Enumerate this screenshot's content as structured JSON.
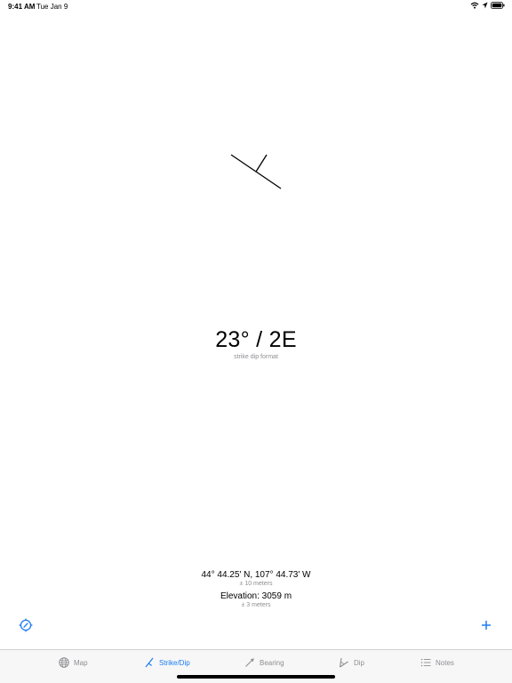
{
  "status": {
    "time": "9:41 AM",
    "date": "Tue Jan 9",
    "icons": [
      "wifi-icon",
      "location-arrow-icon",
      "battery-icon"
    ]
  },
  "reading": {
    "value": "23° / 2E",
    "format": "strike dip format"
  },
  "location": {
    "coords": "44° 44.25' N, 107° 44.73' W",
    "coords_accuracy": "± 10 meters",
    "elevation": "Elevation: 3059 m",
    "elevation_accuracy": "± 3 meters"
  },
  "tabs": [
    {
      "label": "Map",
      "icon": "globe-icon",
      "active": false
    },
    {
      "label": "Strike/Dip",
      "icon": "strike-dip-icon",
      "active": true
    },
    {
      "label": "Bearing",
      "icon": "bearing-icon",
      "active": false
    },
    {
      "label": "Dip",
      "icon": "dip-icon",
      "active": false
    },
    {
      "label": "Notes",
      "icon": "list-icon",
      "active": false
    }
  ],
  "colors": {
    "accent": "#1a7cf2",
    "inactive": "#8e8e93",
    "tab_bar_bg": "#f7f7f7"
  }
}
